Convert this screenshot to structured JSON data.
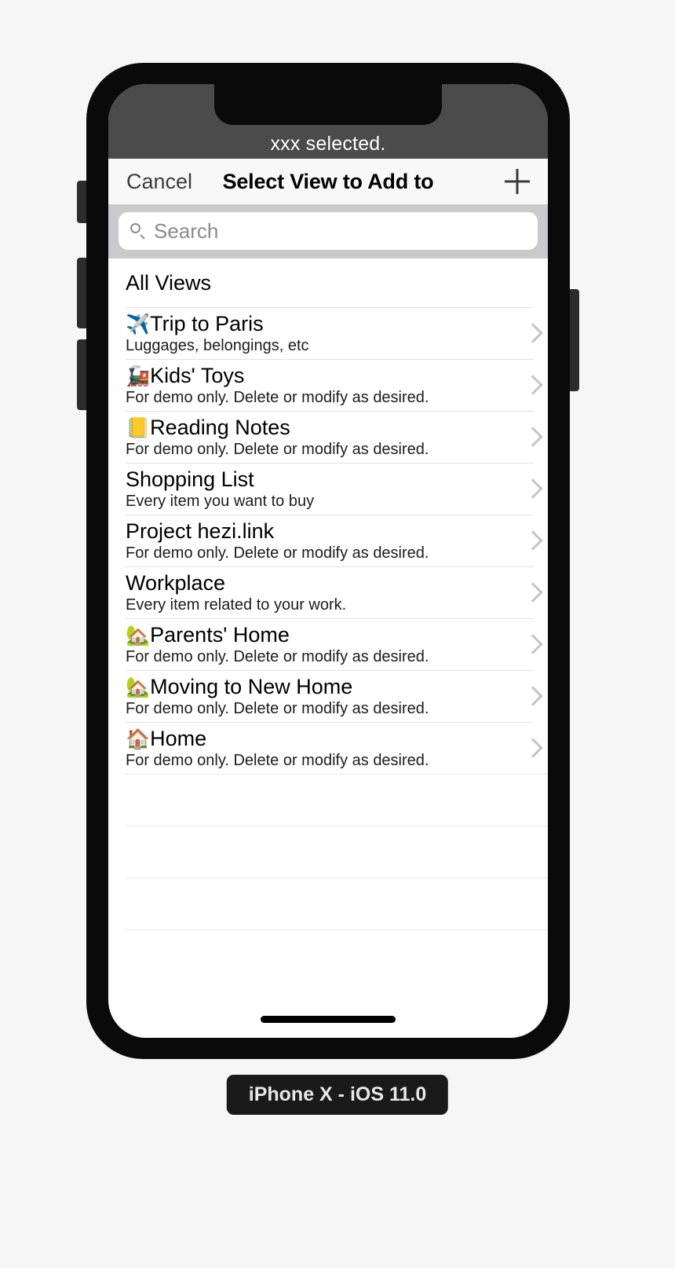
{
  "status_bar": {
    "text": "xxx selected."
  },
  "nav_bar": {
    "cancel_label": "Cancel",
    "title": "Select View to Add to",
    "add_label": "+"
  },
  "search": {
    "placeholder": "Search",
    "value": "",
    "icon": "search-icon"
  },
  "list": {
    "section_header": "All Views",
    "chevron_icon": "chevron-right-icon",
    "empty_row_count": 4,
    "items": [
      {
        "emoji": "✈️",
        "emoji_name": "airplane-icon",
        "title": "Trip to Paris",
        "subtitle": "Luggages, belongings, etc"
      },
      {
        "emoji": "🚂",
        "emoji_name": "locomotive-icon",
        "title": "Kids' Toys",
        "subtitle": "For demo only. Delete or modify as desired."
      },
      {
        "emoji": "📒",
        "emoji_name": "notebook-icon",
        "title": "Reading Notes",
        "subtitle": "For demo only. Delete or modify as desired."
      },
      {
        "emoji": "",
        "emoji_name": "",
        "title": "Shopping List",
        "subtitle": "Every item you want to buy"
      },
      {
        "emoji": "",
        "emoji_name": "",
        "title": "Project hezi.link",
        "subtitle": "For demo only. Delete or modify as desired."
      },
      {
        "emoji": "",
        "emoji_name": "",
        "title": "Workplace",
        "subtitle": "Every item related to your work."
      },
      {
        "emoji": "🏡",
        "emoji_name": "house-with-garden-icon",
        "title": "Parents' Home",
        "subtitle": "For demo only. Delete or modify as desired."
      },
      {
        "emoji": "🏡",
        "emoji_name": "house-with-garden-icon",
        "title": "Moving to New Home",
        "subtitle": "For demo only. Delete or modify as desired."
      },
      {
        "emoji": "🏠",
        "emoji_name": "house-icon",
        "title": "Home",
        "subtitle": "For demo only. Delete or modify as desired."
      }
    ]
  },
  "device": {
    "label": "iPhone X - iOS 11.0"
  },
  "colors": {
    "status_bar_bg": "#4b4b4b",
    "nav_bar_bg": "#f8f8f8",
    "search_bar_bg": "#c9c9ce",
    "separator": "#e2e2e4",
    "chevron": "#c4c4c6",
    "page_bg": "#f6f6f6",
    "frame": "#0a0a0a"
  }
}
